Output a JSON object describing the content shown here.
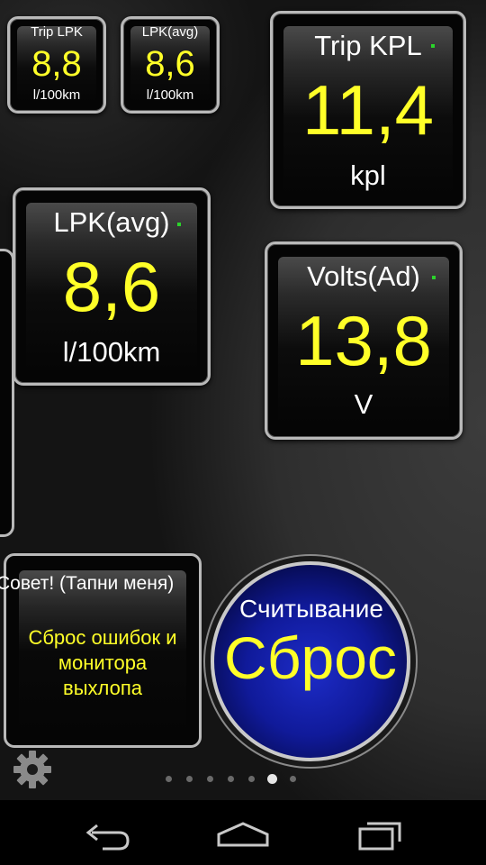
{
  "gauges": {
    "trip_lpk": {
      "title": "Trip LPK",
      "value": "8,8",
      "unit": "l/100km"
    },
    "lpk_avg_small": {
      "title": "LPK(avg)",
      "value": "8,6",
      "unit": "l/100km"
    },
    "trip_kpl": {
      "title": "Trip KPL",
      "value": "11,4",
      "unit": "kpl"
    },
    "lpk_avg_large": {
      "title": "LPK(avg)",
      "value": "8,6",
      "unit": "l/100km"
    },
    "volts": {
      "title": "Volts(Ad)",
      "value": "13,8",
      "unit": "V"
    }
  },
  "tip": {
    "title": "Совет! (Тапни меня)",
    "line1": "Сброс ошибок и",
    "line2": "монитора",
    "line3": "выхлопа"
  },
  "round_button": {
    "title": "Считывание",
    "value": "Сброс"
  },
  "pager": {
    "count": 7,
    "active_index": 5
  },
  "icons": {
    "settings": "gear-icon",
    "back": "back-icon",
    "home": "home-icon",
    "recents": "recent-apps-icon"
  },
  "colors": {
    "value_text": "#ffff28",
    "indicator": "#2bd42b",
    "round_fill": "#1d2cc8"
  }
}
